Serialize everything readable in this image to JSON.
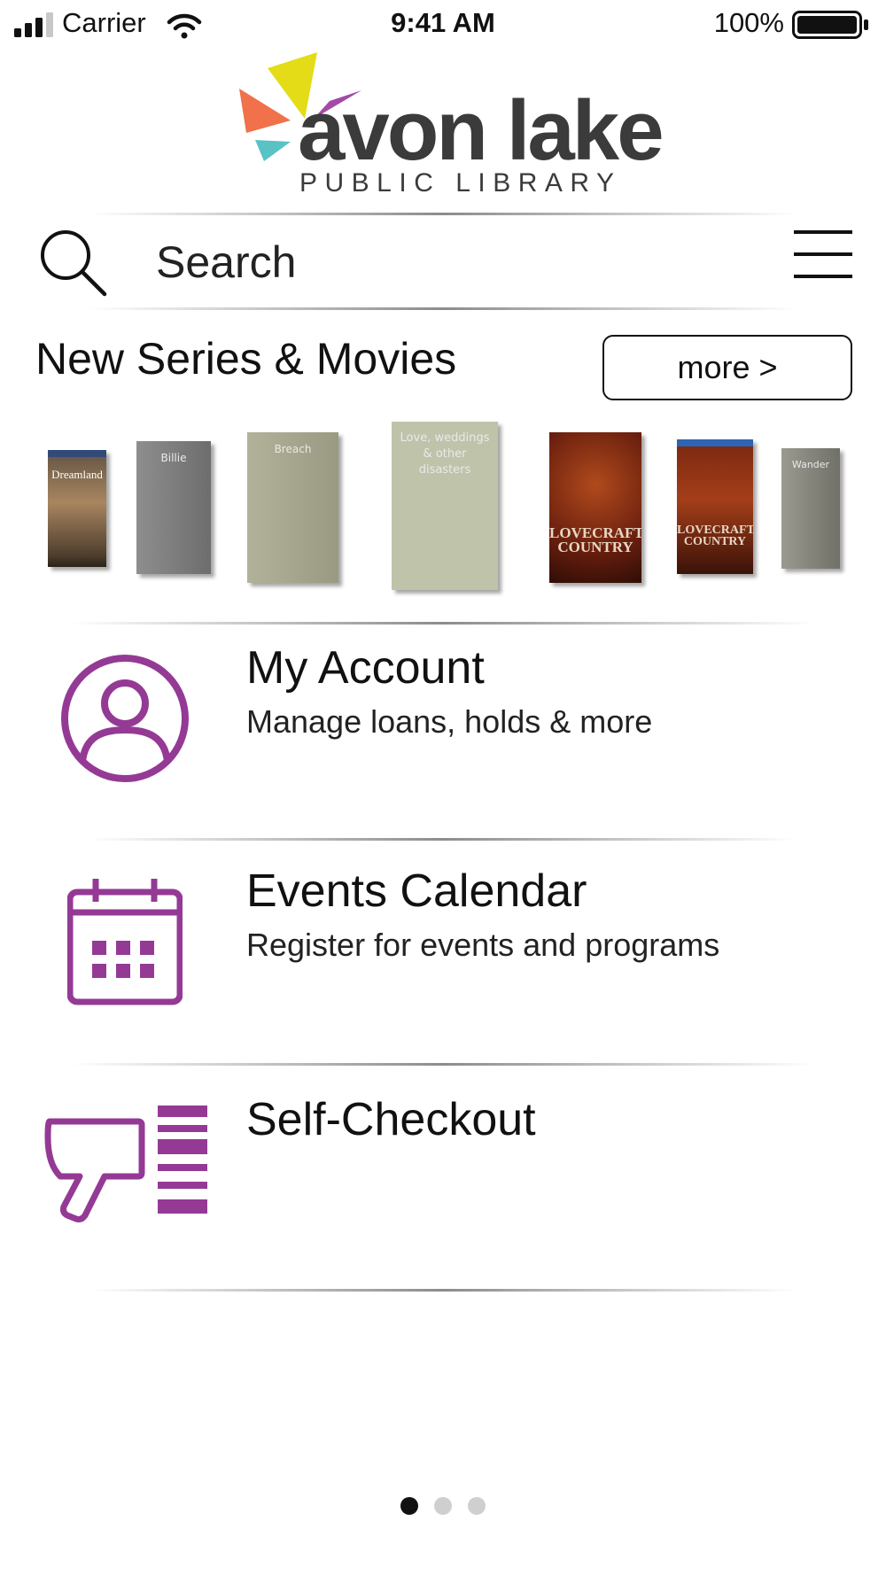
{
  "status_bar": {
    "carrier": "Carrier",
    "time": "9:41 AM",
    "battery": "100%"
  },
  "logo": {
    "word": "avon lake",
    "subtitle": "PUBLIC LIBRARY",
    "colors": {
      "yellow": "#e4dc16",
      "orange": "#f0714a",
      "purple": "#a44aa6",
      "teal": "#58c2c5"
    }
  },
  "search": {
    "placeholder": "Search"
  },
  "new_items": {
    "title": "New Series & Movies",
    "more_label": "more >",
    "covers": [
      {
        "title": "Dreamland",
        "kind": "poster"
      },
      {
        "title": "Billie",
        "kind": "placeholder"
      },
      {
        "title": "Breach",
        "kind": "placeholder"
      },
      {
        "title": "Love, weddings & other disasters",
        "kind": "placeholder"
      },
      {
        "title": "LOVECRAFT COUNTRY",
        "kind": "poster"
      },
      {
        "title": "LOVECRAFT COUNTRY",
        "kind": "poster"
      },
      {
        "title": "Wander",
        "kind": "placeholder"
      }
    ]
  },
  "menu": {
    "account": {
      "title": "My Account",
      "subtitle": "Manage loans, holds & more"
    },
    "events": {
      "title": "Events Calendar",
      "subtitle": "Register for events and programs"
    },
    "checkout": {
      "title": "Self-Checkout"
    }
  },
  "accent_color": "#943a95",
  "pagination": {
    "pages": 3,
    "current": 1
  }
}
